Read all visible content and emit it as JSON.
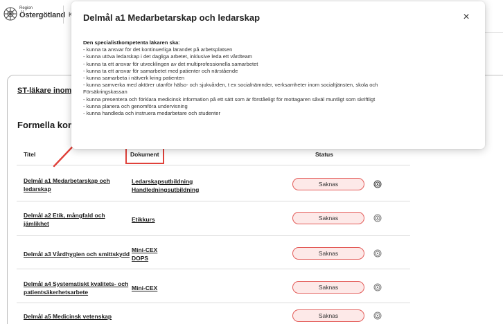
{
  "header": {
    "logo_small": "Region",
    "logo_name": "Östergötland",
    "nav_fragment": "Ko"
  },
  "card": {
    "link_text": "ST-läkare inom",
    "section_title": "Formella kompe"
  },
  "table": {
    "columns": {
      "title": "Titel",
      "document": "Dokument",
      "status": "Status"
    },
    "rows": [
      {
        "title": "Delmål a1 Medarbetarskap och ledarskap",
        "documents": [
          "Ledarskapsutbildning",
          "Handledningsutbildning"
        ],
        "status": "Saknas"
      },
      {
        "title": "Delmål a2 Etik, mångfald och jämlikhet",
        "documents": [
          "Etikkurs"
        ],
        "status": "Saknas"
      },
      {
        "title": "Delmål a3 Vårdhygien och smittskydd",
        "documents": [
          "Mini-CEX",
          "DOPS"
        ],
        "status": "Saknas"
      },
      {
        "title": "Delmål a4 Systematiskt kvalitets- och patientsäkerhetsarbete",
        "documents": [
          "Mini-CEX"
        ],
        "status": "Saknas"
      },
      {
        "title": "Delmål a5 Medicinsk vetenskap",
        "documents": [],
        "status": "Saknas"
      }
    ]
  },
  "modal": {
    "title": "Delmål a1 Medarbetarskap och ledarskap",
    "close_symbol": "×",
    "intro": "Den specialistkompetenta läkaren ska:",
    "items": [
      "- kunna ta ansvar för det kontinuerliga lärandet på arbetsplatsen",
      "- kunna utöva ledarskap i det dagliga arbetet, inklusive leda ett vårdteam",
      "- kunna ta ett ansvar för utvecklingen av det multiprofessionella samarbetet",
      "- kunna ta ett ansvar för samarbetet med patienter och närstående",
      "- kunna samarbeta i nätverk kring patienten",
      "- kunna samverka med aktörer utanför hälso- och sjukvården, t ex socialnämnder, verksamheter inom socialtjänsten, skola och",
      "Försäkringskassan",
      "- kunna presentera och förklara medicinsk information på ett sätt som är förståeligt för mottagaren såväl muntligt som skriftligt",
      "- kunna planera och genomföra undervisning",
      "- kunna handleda och instruera medarbetare och studenter"
    ]
  },
  "colors": {
    "badge_border": "#e35b58",
    "badge_fill": "#fde9e8",
    "annotation_red": "#e0413a"
  },
  "icons": {
    "logo": "region-logo-icon",
    "close": "close-icon",
    "status": "target-icon"
  }
}
